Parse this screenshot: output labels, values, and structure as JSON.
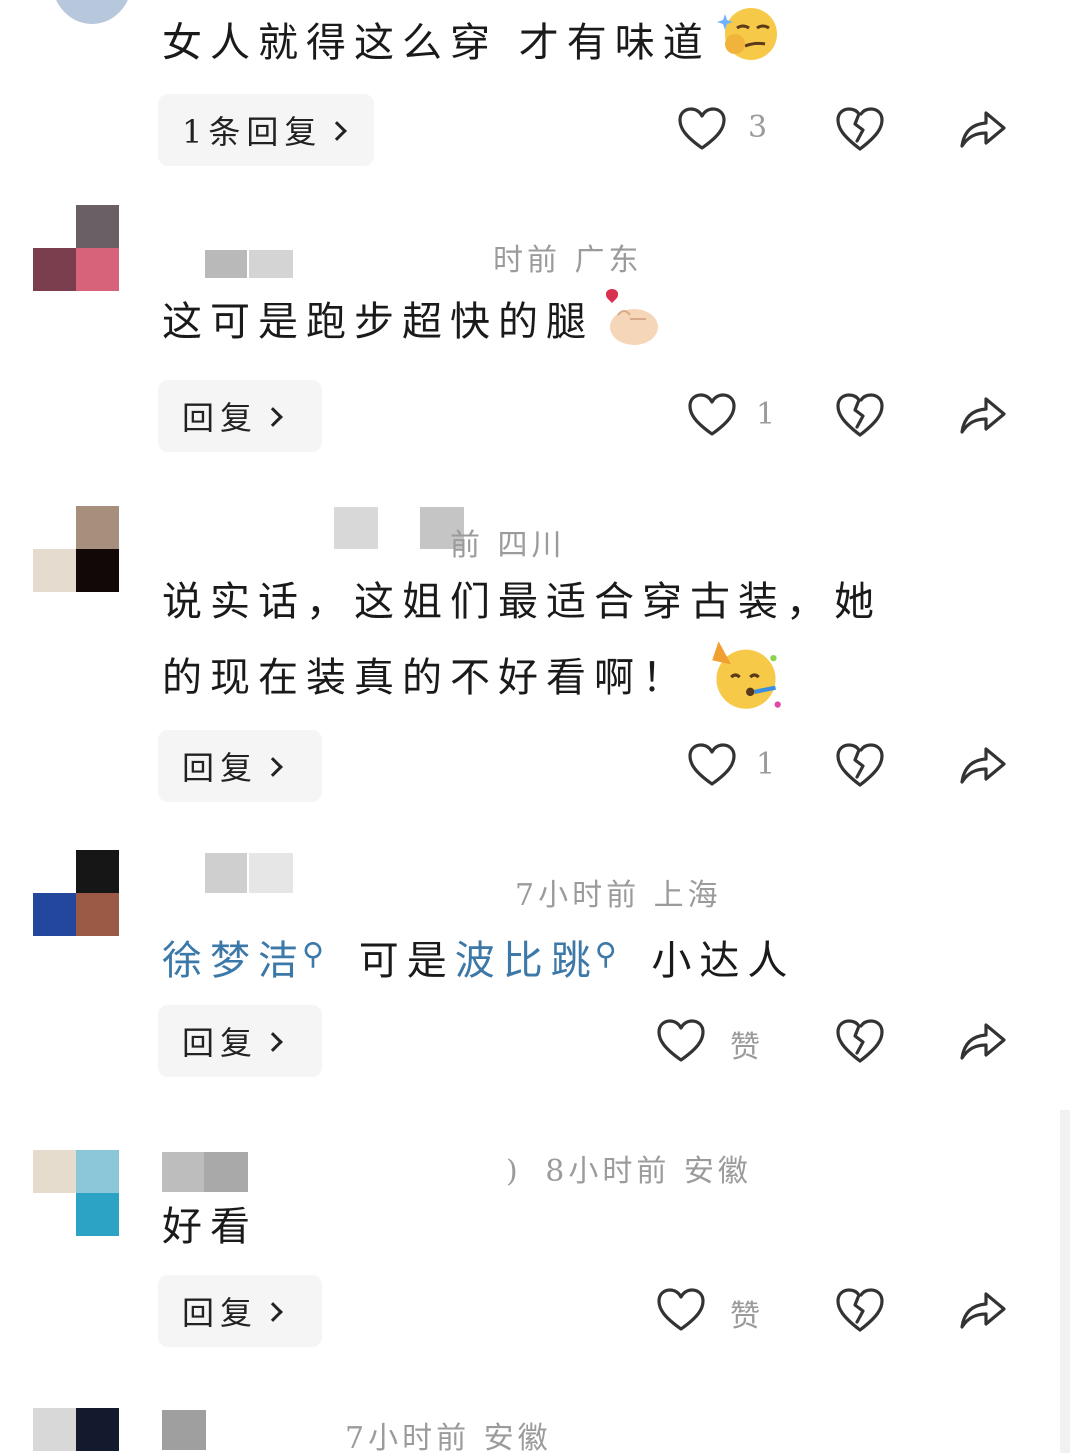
{
  "comments": [
    {
      "meta": "",
      "text": "女人就得这么穿 才有味道",
      "reply_label": "1条回复",
      "likes": "3",
      "emoji": "smirk-emoji"
    },
    {
      "meta": "时前 广东",
      "text": "这可是跑步超快的腿",
      "reply_label": "回复",
      "likes": "1",
      "emoji": "finger-heart-emoji"
    },
    {
      "meta": "前 四川",
      "text_line1": "说实话，这姐们最适合穿古装，她",
      "text_line2": "的现在装真的不好看啊！",
      "reply_label": "回复",
      "likes": "1",
      "emoji": "party-face-emoji"
    },
    {
      "meta": "7小时前 上海",
      "link1": "徐梦洁",
      "mid": "可是",
      "link2": "波比跳",
      "tail": "小达人",
      "reply_label": "回复",
      "likes": "赞"
    },
    {
      "meta": "8小时前 安徽",
      "meta_prefix": ")",
      "text": "好看",
      "reply_label": "回复",
      "likes": "赞"
    },
    {
      "meta": "7小时前 安徽"
    }
  ],
  "icons": {
    "like": "heart-outline-icon",
    "dislike": "broken-heart-icon",
    "share": "share-arrow-icon",
    "search_tag": "search-magnifier-icon"
  },
  "colors": {
    "link": "#3c78a8",
    "meta": "#9b9b9b",
    "button_bg": "#f5f5f5"
  }
}
